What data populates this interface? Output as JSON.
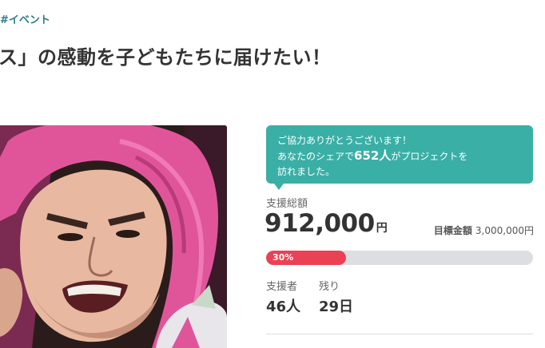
{
  "project": {
    "category_tag": "#イベント",
    "title_visible": "ス」の感動を子どもたちに届けたい！"
  },
  "notice": {
    "line1": "ご協力ありがとうございます！",
    "line2_prefix": "あなたのシェアで",
    "count": "652人",
    "line2_suffix": "がプロジェクトを",
    "line3": "訪れました。"
  },
  "funding": {
    "raised_label": "支援総額",
    "raised_amount": "912,000",
    "raised_unit": "円",
    "target_label": "目標金額",
    "target_amount": "3,000,000円",
    "progress_percent": 30,
    "progress_text": "30%",
    "supporters_label": "支援者",
    "supporters_value": "46人",
    "remaining_label": "残り",
    "remaining_value": "29日"
  },
  "colors": {
    "accent_teal": "#3aafa6",
    "progress_red": "#eb4155",
    "tag_teal": "#2e7d84"
  }
}
